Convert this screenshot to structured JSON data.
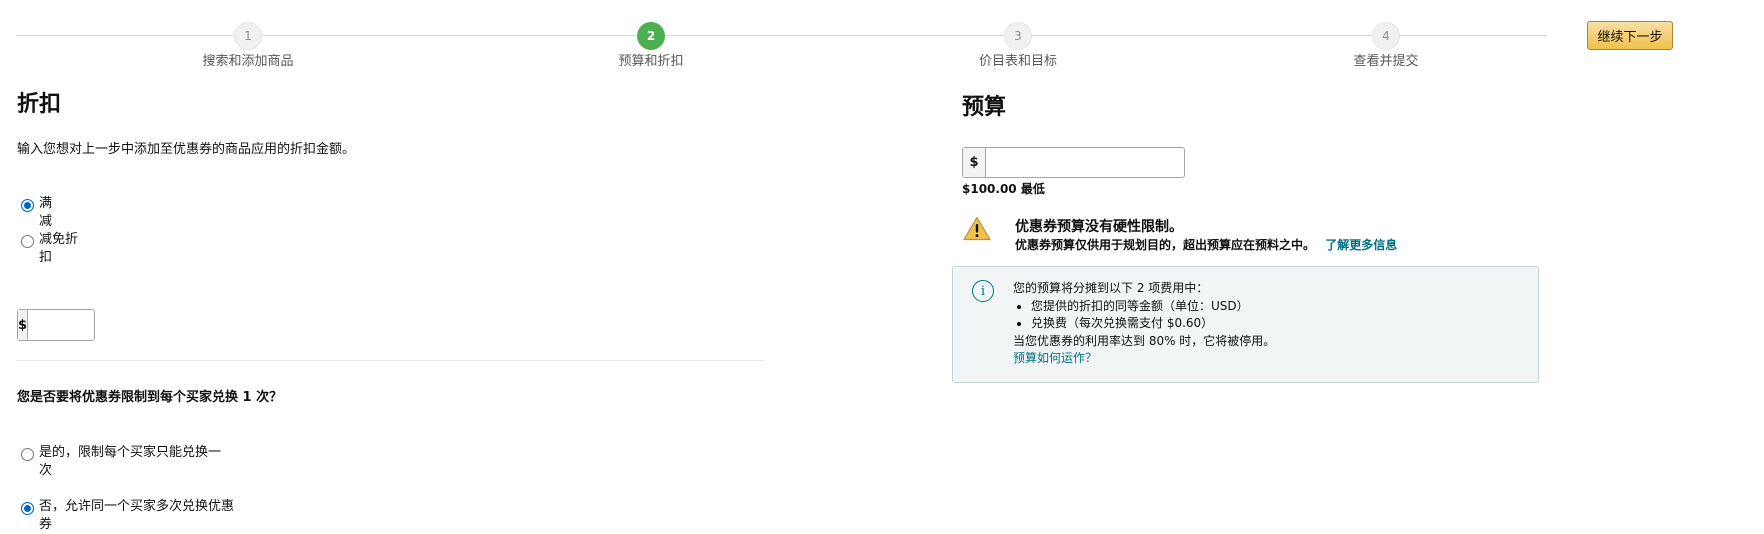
{
  "stepper": {
    "steps": [
      {
        "number": "1",
        "label": "搜索和添加商品"
      },
      {
        "number": "2",
        "label": "预算和折扣"
      },
      {
        "number": "3",
        "label": "价目表和目标"
      },
      {
        "number": "4",
        "label": "查看并提交"
      }
    ],
    "active_step": 2,
    "continue_label": "继续下一步"
  },
  "discount": {
    "title": "折扣",
    "description": "输入您想对上一步中添加至优惠券的商品应用的折扣金额。",
    "options": [
      {
        "label_line1": "满",
        "label_line2": "减",
        "checked": true
      },
      {
        "label_line1": "减免折",
        "label_line2": "扣",
        "checked": false
      }
    ],
    "currency_symbol": "$",
    "amount_value": ""
  },
  "redemption": {
    "question": "您是否要将优惠券限制到每个买家兑换 1 次？",
    "options": [
      {
        "label_line1": "是的，限制每个买家只能兑换一",
        "label_line2": "次",
        "checked": false
      },
      {
        "label_line1": "否，允许同一个买家多次兑换优惠",
        "label_line2": "券",
        "checked": true
      }
    ]
  },
  "budget": {
    "title": "预算",
    "currency_symbol": "$",
    "amount_value": "",
    "minimum_amount": "$100.00",
    "minimum_label": "最低",
    "warning_title": "优惠券预算没有硬性限制。",
    "warning_text": "优惠券预算仅供用于规划目的，超出预算应在预料之中。",
    "warning_link": "了解更多信息",
    "info": {
      "intro": "您的预算将分摊到以下 2 项费用中：",
      "bullets": [
        "您提供的折扣的同等金额（单位：USD）",
        "兑换费（每次兑换需支付 $0.60）"
      ],
      "note": "当您优惠券的利用率达到 80% 时，它将被停用。",
      "link": "预算如何运作？"
    }
  },
  "colors": {
    "active_step": "#4caf50",
    "link": "#007185",
    "button": "#f0c14b",
    "warning": "#f0c14b"
  }
}
